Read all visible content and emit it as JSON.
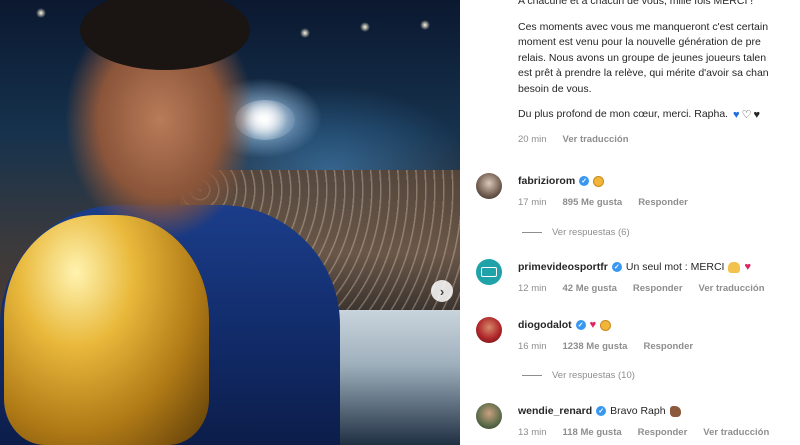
{
  "post": {
    "caption_lines": [
      "A chacune et à chacun de vous, mille fois MERCI !",
      "Ces moments avec vous me manqueront c'est certain",
      "moment est venu pour la nouvelle génération de pre",
      "relais. Nous avons un groupe de jeunes joueurs talen",
      "est prêt à prendre la relève, qui mérite d'avoir sa chan",
      "besoin de vous.",
      "Du plus profond de mon cœur, merci. Rapha."
    ],
    "caption_meta": {
      "time": "20 min",
      "translate": "Ver traducción"
    },
    "hearts": [
      "blue-heart-icon",
      "white-heart-icon",
      "black-heart-icon"
    ]
  },
  "comments": [
    {
      "username": "fabriziorom",
      "text": "",
      "emoji": [
        "clap-icon"
      ],
      "time": "17 min",
      "likes": "895 Me gusta",
      "reply": "Responder",
      "translate": "",
      "replies": "Ver respuestas (6)"
    },
    {
      "username": "primevideosportfr",
      "text": "Un seul mot : MERCI",
      "emoji": [
        "pray-icon",
        "red-heart-icon"
      ],
      "time": "12 min",
      "likes": "42 Me gusta",
      "reply": "Responder",
      "translate": "Ver traducción",
      "replies": ""
    },
    {
      "username": "diogodalot",
      "text": "",
      "emoji": [
        "red-heart-icon",
        "clap-icon"
      ],
      "time": "16 min",
      "likes": "1238 Me gusta",
      "reply": "Responder",
      "translate": "",
      "replies": "Ver respuestas (10)"
    },
    {
      "username": "wendie_renard",
      "text": "Bravo Raph",
      "emoji": [
        "flex-icon"
      ],
      "time": "13 min",
      "likes": "118 Me gusta",
      "reply": "Responder",
      "translate": "Ver traducción",
      "replies": ""
    }
  ],
  "colors": {
    "verified": "#3897f0",
    "meta": "#8e8e8e",
    "text": "#262626"
  }
}
